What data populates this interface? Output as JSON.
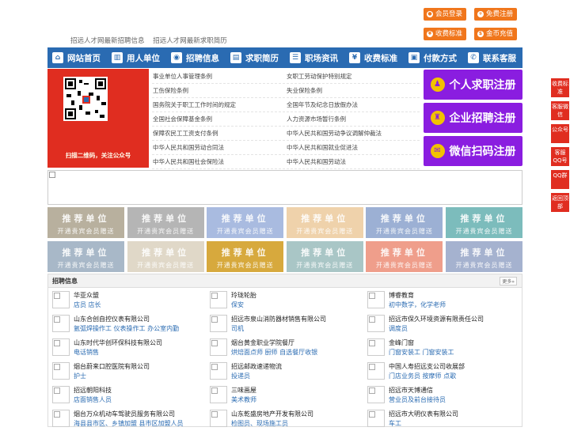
{
  "top_links": [
    "招远人才网最新招聘信息",
    "招远人才网最新求职简历"
  ],
  "top_buttons": [
    "会员登录",
    "免费注册",
    "收费标准",
    "金币充值"
  ],
  "nav": [
    {
      "label": "网站首页",
      "icon": "home-icon",
      "glyph": "⌂"
    },
    {
      "label": "用人单位",
      "icon": "building-icon",
      "glyph": "▥"
    },
    {
      "label": "招聘信息",
      "icon": "megaphone-icon",
      "glyph": "◉"
    },
    {
      "label": "求职简历",
      "icon": "resume-icon",
      "glyph": "▤"
    },
    {
      "label": "职场资讯",
      "icon": "news-icon",
      "glyph": "☰"
    },
    {
      "label": "收费标准",
      "icon": "fee-icon",
      "glyph": "¥"
    },
    {
      "label": "付款方式",
      "icon": "payment-icon",
      "glyph": "▣"
    },
    {
      "label": "联系客服",
      "icon": "phone-icon",
      "glyph": "✆"
    }
  ],
  "qr_caption": "扫描二维码，关注公众号",
  "laws": [
    [
      "事业单位人事管理条例",
      "女职工劳动保护特别规定"
    ],
    [
      "工伤保险条例",
      "失业保险条例"
    ],
    [
      "国务院关于职工工作时间的规定",
      "全国年节及纪念日放假办法"
    ],
    [
      "全国社会保障基金条例",
      "人力资源市场暂行条例"
    ],
    [
      "保障农民工工资支付条例",
      "中华人民共和国劳动争议调解仲裁法"
    ],
    [
      "中华人民共和国劳动合同法",
      "中华人民共和国就业促进法"
    ],
    [
      "中华人民共和国社会保险法",
      "中华人民共和国劳动法"
    ]
  ],
  "register": [
    {
      "label": "个人求职注册",
      "glyph": "♟"
    },
    {
      "label": "企业招聘注册",
      "glyph": "♜"
    },
    {
      "label": "微信扫码注册",
      "glyph": "✉"
    }
  ],
  "recommend": {
    "title": "推荐单位",
    "subtitle": "开通贵宾会员赠送"
  },
  "tile_colors": [
    "#b8b09e",
    "#b5b5b5",
    "#a9bbe0",
    "#efd2ab",
    "#9cb0d4",
    "#7cbcbc",
    "#a8b8c8",
    "#e0d8c8",
    "#d7a93d",
    "#a9c6c6",
    "#ef9e8b",
    "#a5b2cf"
  ],
  "jobs_title": "招聘信息",
  "more_label": "更多»",
  "jobs": [
    {
      "company": "华亚众盟",
      "position": "店员 店长"
    },
    {
      "company": "玲珑轮胎",
      "position": "保安"
    },
    {
      "company": "博睿教育",
      "position": "初中数学，化学老师"
    },
    {
      "company": "山东合创自控仪表有限公司",
      "position": "氩弧焊操作工 仪表操作工 办公室内勤"
    },
    {
      "company": "招远市泉山消防器材销售有限公司",
      "position": "司机"
    },
    {
      "company": "招远市保久环境资源有限责任公司",
      "position": "调度员"
    },
    {
      "company": "山东时代华创环保科技有限公司",
      "position": "电话销售"
    },
    {
      "company": "烟台黄金职业学院餐厅",
      "position": "烘焙面点师 厨师 自选餐厅收银"
    },
    {
      "company": "金峰门窗",
      "position": "门窗安装工 门窗安装工"
    },
    {
      "company": "烟台蔚来口腔医院有限公司",
      "position": "护士"
    },
    {
      "company": "招远邮政速递物流",
      "position": "投递员"
    },
    {
      "company": "中国人寿招远支公司收展部",
      "position": "门店业务员 按摩师 点歌"
    },
    {
      "company": "招远朝阳科技",
      "position": "店面销售人员"
    },
    {
      "company": "三味画屋",
      "position": "美术教师"
    },
    {
      "company": "招远市天博通信",
      "position": "营业员及前台接待员"
    },
    {
      "company": "烟台万众机动车驾驶员服务有限公司",
      "position": "海县县市区、乡镇加盟 县市区加盟人员"
    },
    {
      "company": "山东乾盛房地产开发有限公司",
      "position": "检图员、现场施工员"
    },
    {
      "company": "招远市大明仪表有限公司",
      "position": "车工"
    }
  ],
  "side_tabs": [
    "收费标准",
    "客服微信",
    "公众号",
    "客服QQ号",
    "QQ群",
    "返回顶部"
  ]
}
